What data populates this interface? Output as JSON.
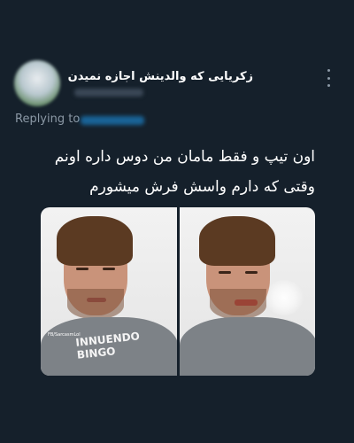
{
  "tweet": {
    "display_name": "زکریایی که والدینش اجازه نمیدن",
    "replying_to_label": "Replying to",
    "text_lines": [
      "اون تیپ و فقط مامان من دوس داره اونم",
      "وقتی که دارم واسش فرش میشورم"
    ],
    "more_icon": "more-vertical-icon"
  },
  "media": {
    "panel_left": {
      "watermark": "FB/SarcasmLol",
      "shirt_lines": [
        "INNUENDO",
        "BINGO"
      ]
    },
    "panel_right": {}
  },
  "colors": {
    "background": "#15202b",
    "text": "#ffffff",
    "secondary_text": "#8b98a5",
    "link": "#1d9bf0"
  }
}
